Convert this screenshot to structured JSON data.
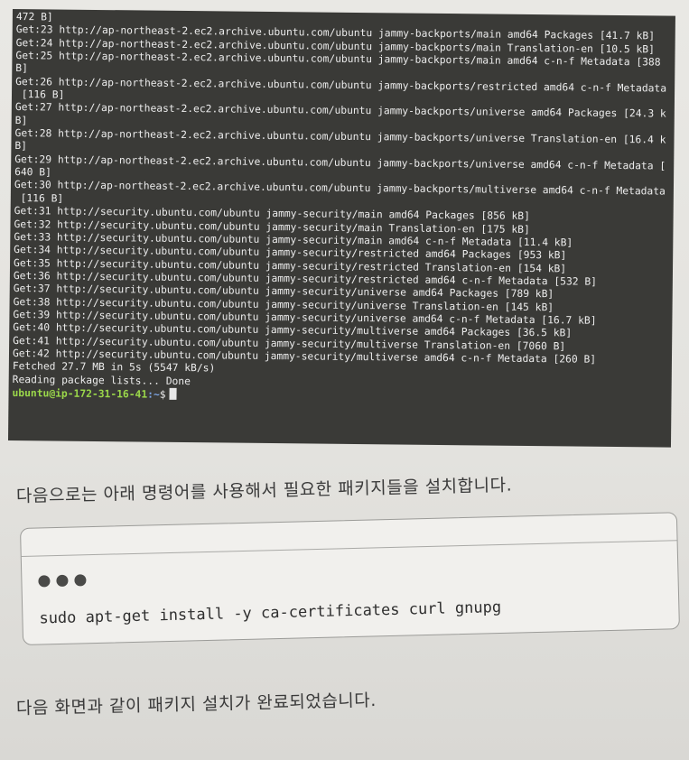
{
  "terminal": {
    "lines": [
      "472 B]",
      "Get:23 http://ap-northeast-2.ec2.archive.ubuntu.com/ubuntu jammy-backports/main amd64 Packages [41.7 kB]",
      "Get:24 http://ap-northeast-2.ec2.archive.ubuntu.com/ubuntu jammy-backports/main Translation-en [10.5 kB]",
      "Get:25 http://ap-northeast-2.ec2.archive.ubuntu.com/ubuntu jammy-backports/main amd64 c-n-f Metadata [388",
      "B]",
      "Get:26 http://ap-northeast-2.ec2.archive.ubuntu.com/ubuntu jammy-backports/restricted amd64 c-n-f Metadata",
      " [116 B]",
      "Get:27 http://ap-northeast-2.ec2.archive.ubuntu.com/ubuntu jammy-backports/universe amd64 Packages [24.3 k",
      "B]",
      "Get:28 http://ap-northeast-2.ec2.archive.ubuntu.com/ubuntu jammy-backports/universe Translation-en [16.4 k",
      "B]",
      "Get:29 http://ap-northeast-2.ec2.archive.ubuntu.com/ubuntu jammy-backports/universe amd64 c-n-f Metadata [",
      "640 B]",
      "Get:30 http://ap-northeast-2.ec2.archive.ubuntu.com/ubuntu jammy-backports/multiverse amd64 c-n-f Metadata",
      " [116 B]",
      "Get:31 http://security.ubuntu.com/ubuntu jammy-security/main amd64 Packages [856 kB]",
      "Get:32 http://security.ubuntu.com/ubuntu jammy-security/main Translation-en [175 kB]",
      "Get:33 http://security.ubuntu.com/ubuntu jammy-security/main amd64 c-n-f Metadata [11.4 kB]",
      "Get:34 http://security.ubuntu.com/ubuntu jammy-security/restricted amd64 Packages [953 kB]",
      "Get:35 http://security.ubuntu.com/ubuntu jammy-security/restricted Translation-en [154 kB]",
      "Get:36 http://security.ubuntu.com/ubuntu jammy-security/restricted amd64 c-n-f Metadata [532 B]",
      "Get:37 http://security.ubuntu.com/ubuntu jammy-security/universe amd64 Packages [789 kB]",
      "Get:38 http://security.ubuntu.com/ubuntu jammy-security/universe Translation-en [145 kB]",
      "Get:39 http://security.ubuntu.com/ubuntu jammy-security/universe amd64 c-n-f Metadata [16.7 kB]",
      "Get:40 http://security.ubuntu.com/ubuntu jammy-security/multiverse amd64 Packages [36.5 kB]",
      "Get:41 http://security.ubuntu.com/ubuntu jammy-security/multiverse Translation-en [7060 B]",
      "Get:42 http://security.ubuntu.com/ubuntu jammy-security/multiverse amd64 c-n-f Metadata [260 B]",
      "Fetched 27.7 MB in 5s (5547 kB/s)",
      "Reading package lists... Done"
    ],
    "prompt_user": "ubuntu@ip-172-31-16-41",
    "prompt_path": ":~",
    "prompt_symbol": "$"
  },
  "paragraph1": "다음으로는 아래 명령어를 사용해서 필요한 패키지들을 설치합니다.",
  "code_block": {
    "command": "sudo apt-get install -y ca-certificates curl gnupg"
  },
  "paragraph2": "다음 화면과 같이 패키지 설치가 완료되었습니다.",
  "colors": {
    "terminal_bg": "#3a3a37",
    "prompt_user": "#9bd84a",
    "prompt_path": "#7fa8e8"
  }
}
